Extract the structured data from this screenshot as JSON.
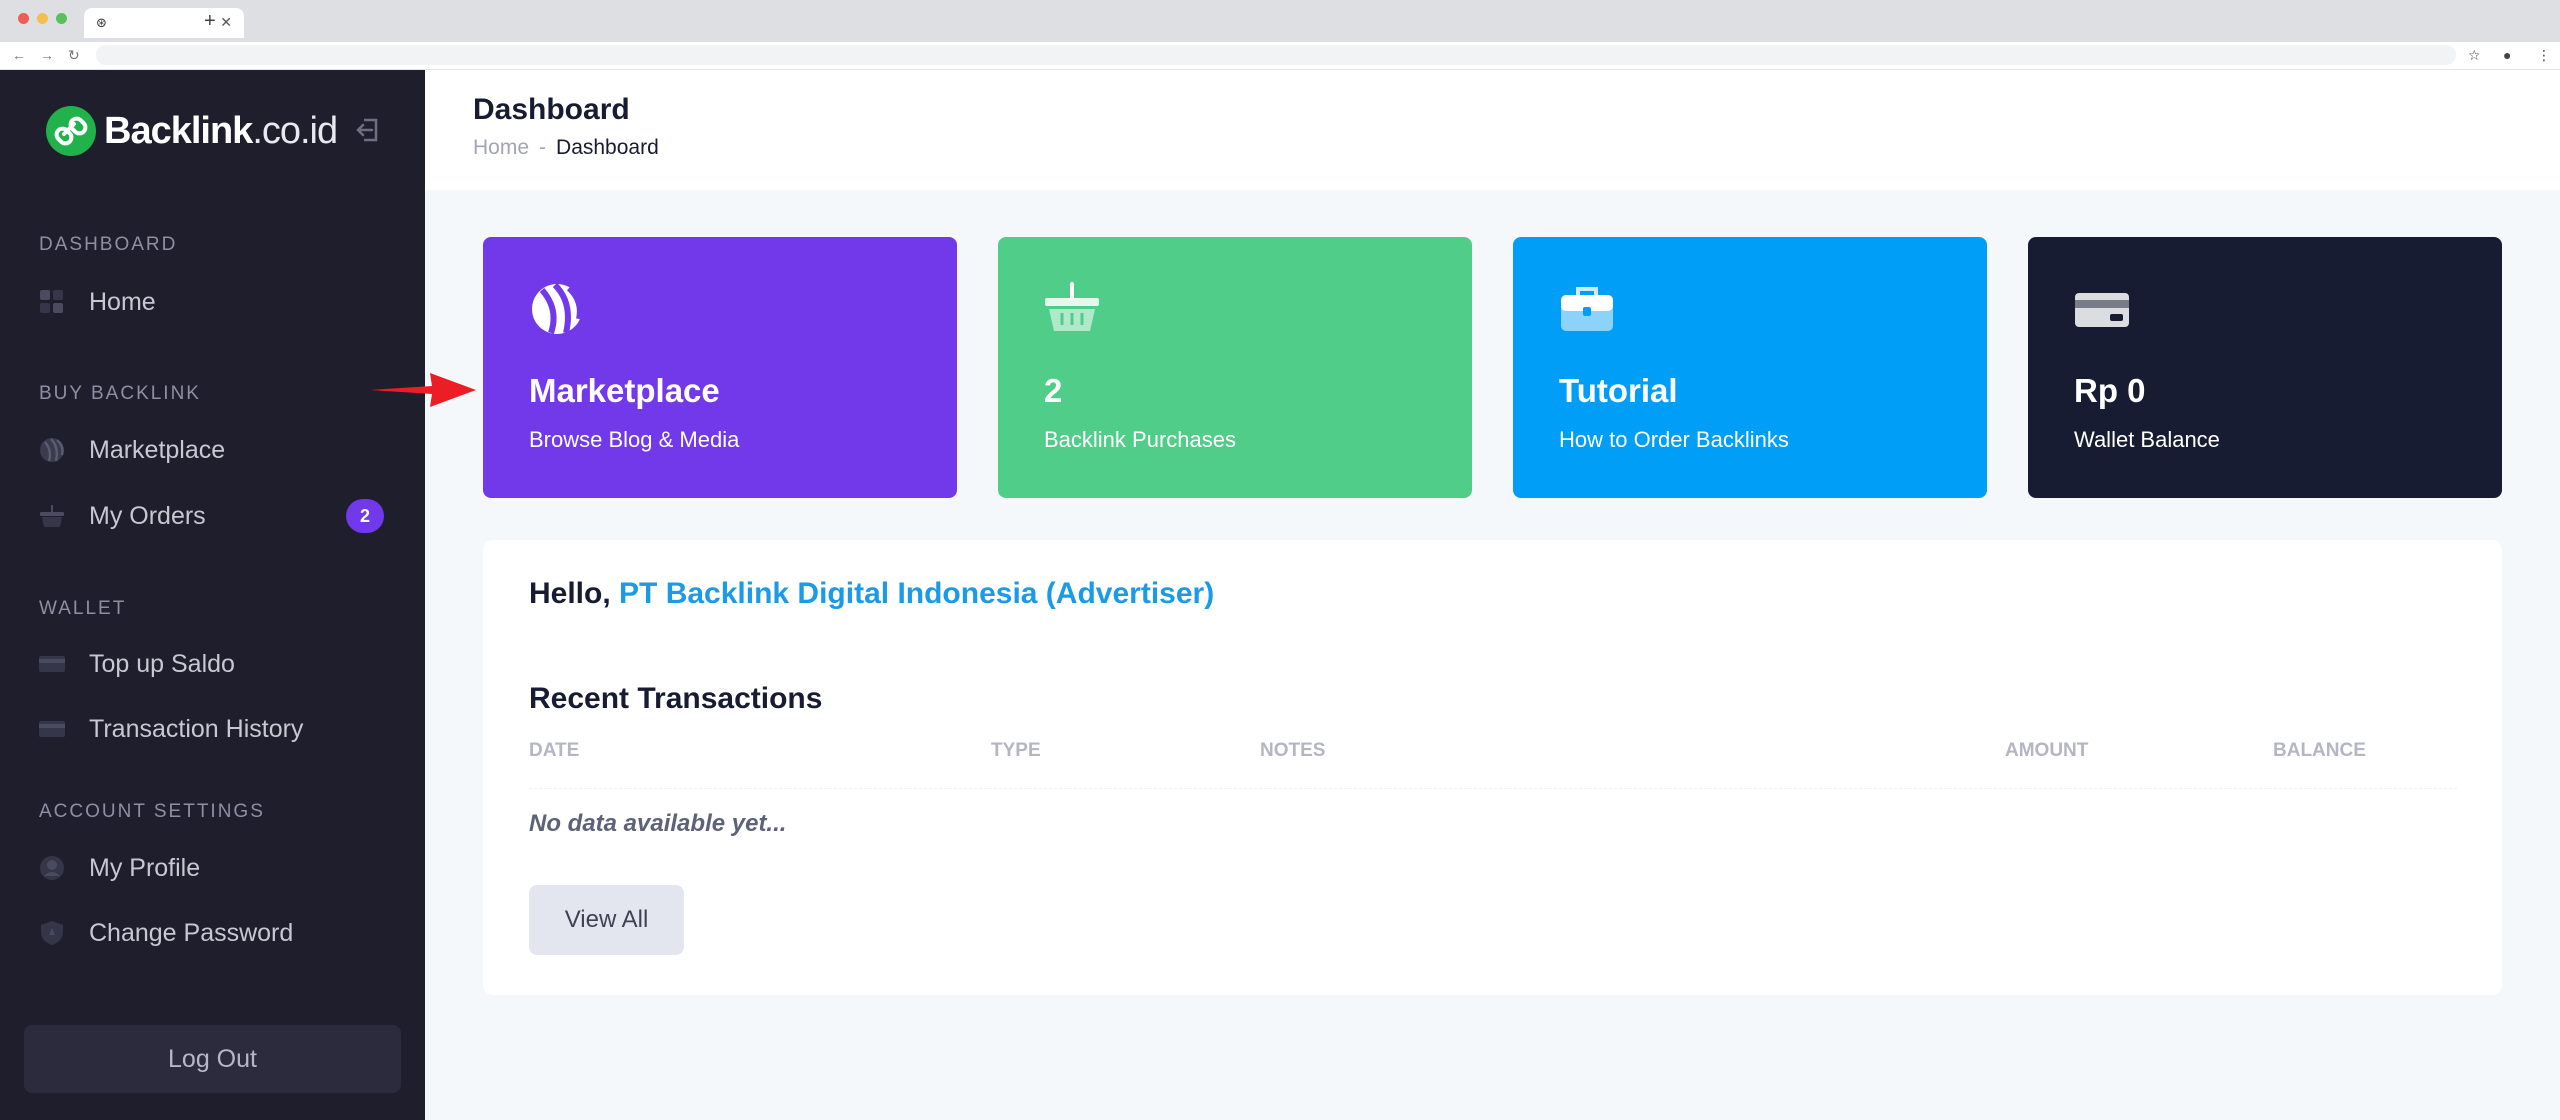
{
  "browser": {
    "tab_favicon": "⊛",
    "tab_close": "✕",
    "new_tab": "+",
    "back_icon": "←",
    "forward_icon": "→",
    "reload_icon": "↻",
    "star_icon": "☆",
    "profile_icon": "●",
    "menu_icon": "⋮"
  },
  "sidebar": {
    "logo": {
      "bold": "Backlink",
      "light": ".co.id",
      "color": "#21b24b"
    },
    "sections": [
      {
        "title": "DASHBOARD",
        "items": [
          {
            "label": "Home",
            "icon": "grid-icon"
          }
        ]
      },
      {
        "title": "BUY BACKLINK",
        "items": [
          {
            "label": "Marketplace",
            "icon": "ball-icon"
          },
          {
            "label": "My Orders",
            "icon": "basket-icon",
            "badge": "2"
          }
        ]
      },
      {
        "title": "WALLET",
        "items": [
          {
            "label": "Top up Saldo",
            "icon": "card-icon"
          },
          {
            "label": "Transaction History",
            "icon": "card-icon"
          }
        ]
      },
      {
        "title": "ACCOUNT SETTINGS",
        "items": [
          {
            "label": "My Profile",
            "icon": "user-icon"
          },
          {
            "label": "Change Password",
            "icon": "shield-icon"
          }
        ]
      }
    ],
    "logout_label": "Log Out",
    "bg_color": "#1e1e2d"
  },
  "header": {
    "title": "Dashboard",
    "breadcrumb": {
      "home": "Home",
      "separator": "-",
      "current": "Dashboard"
    }
  },
  "cards": [
    {
      "title": "Marketplace",
      "subtitle": "Browse Blog & Media",
      "color": "#7239ea",
      "icon": "ball-icon"
    },
    {
      "title": "2",
      "subtitle": "Backlink Purchases",
      "color": "#50cd89",
      "icon": "basket-icon"
    },
    {
      "title": "Tutorial",
      "subtitle": "How to Order Backlinks",
      "color": "#009ef7",
      "icon": "briefcase-icon"
    },
    {
      "title": "Rp 0",
      "subtitle": "Wallet Balance",
      "color": "#181c32",
      "icon": "credit-card-icon"
    }
  ],
  "main": {
    "greeting": "Hello,",
    "user_name": "PT Backlink Digital Indonesia (Advertiser)",
    "recent_title": "Recent Transactions",
    "columns": [
      "DATE",
      "TYPE",
      "NOTES",
      "AMOUNT",
      "BALANCE"
    ],
    "empty_text": "No data available yet...",
    "view_all_label": "View All"
  }
}
